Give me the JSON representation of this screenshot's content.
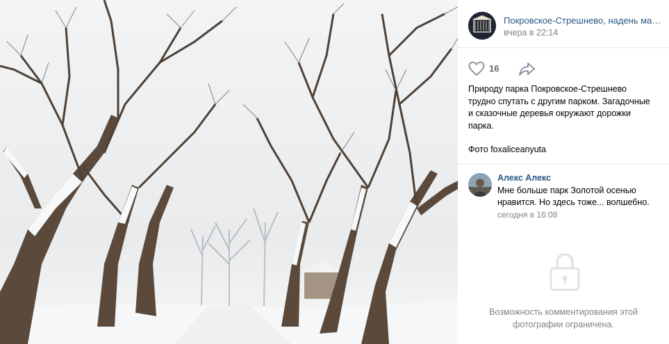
{
  "photo": {
    "subject": "snow-covered-tree-alley"
  },
  "post": {
    "group_name": "Покровское-Стрешнево, надень маску",
    "time": "вчера в 22:14",
    "like_count": "16",
    "text_lines": [
      "Природу парка Покровское-Стрешнево",
      "трудно спутать с другим парком. Загадочные",
      "и сказочные деревья окружают дорожки",
      "парка."
    ],
    "photo_credit": "Фото foxaliceanyuta",
    "icons": {
      "like": "heart-icon",
      "share": "share-arrow-icon",
      "lock": "lock-icon"
    }
  },
  "comment": {
    "author": "Алекс Алекс",
    "text_line1": "Мне больше парк Золотой осенью",
    "text_line2": "нравится. Но здесь тоже... волшебно.",
    "time": "сегодня в 16:08"
  },
  "restriction": {
    "line1": "Возможность комментирования этой",
    "line2": "фотографии ограничена."
  },
  "colors": {
    "link": "#2a5885",
    "muted": "#828282",
    "divider": "#e7e8ec"
  }
}
